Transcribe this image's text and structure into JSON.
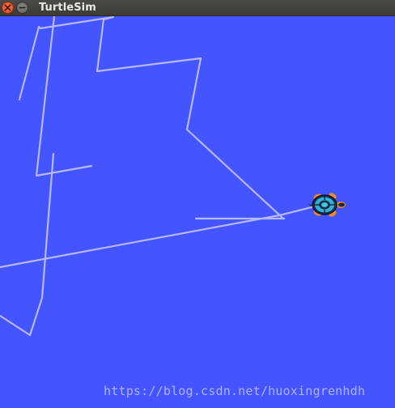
{
  "window": {
    "title": "TurtleSim",
    "close_icon": "close-icon",
    "minimize_icon": "minimize-icon"
  },
  "canvas": {
    "background_color": "#4455ff",
    "pen_color": "#b3b8ff",
    "turtle_icon": "turtle-icon"
  },
  "watermark": {
    "text": "https://blog.csdn.net/huoxingrenhdh"
  }
}
